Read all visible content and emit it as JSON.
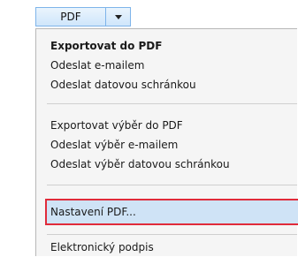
{
  "button": {
    "label": "PDF",
    "dropdown_icon": "chevron-down-icon"
  },
  "menu": {
    "group1": [
      "Exportovat do PDF",
      "Odeslat e-mailem",
      "Odeslat datovou schránkou"
    ],
    "group2": [
      "Exportovat výběr do PDF",
      "Odeslat výběr e-mailem",
      "Odeslat výběr datovou schránkou"
    ],
    "highlighted": "Nastavení PDF...",
    "group3": [
      "Elektronický podpis"
    ]
  },
  "colors": {
    "highlight_border": "#e02b3a",
    "highlight_fill": "#cfe3f6",
    "button_border": "#7eb4ea"
  }
}
